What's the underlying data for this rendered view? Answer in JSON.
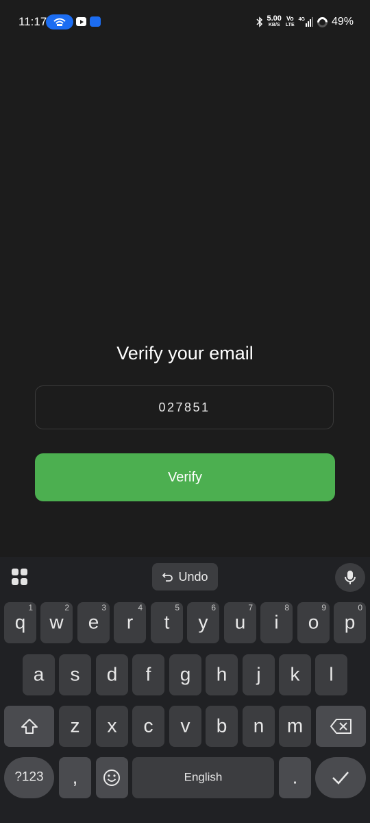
{
  "status_bar": {
    "time": "11:17",
    "net_speed_value": "5.00",
    "net_speed_unit": "KB/S",
    "volte_top": "Vo",
    "volte_bottom": "LTE",
    "network_type": "4G",
    "battery_percent": "49%",
    "icons": [
      "hotspot-icon",
      "youtube-icon",
      "app-icon",
      "bluetooth-icon",
      "signal-icon",
      "battery-icon"
    ]
  },
  "page": {
    "title": "Verify your email",
    "code_value": "027851",
    "verify_label": "Verify",
    "colors": {
      "background": "#1c1c1c",
      "accent": "#4caf50"
    }
  },
  "keyboard": {
    "undo_label": "Undo",
    "rows": {
      "row1": [
        {
          "label": "q",
          "hint": "1"
        },
        {
          "label": "w",
          "hint": "2"
        },
        {
          "label": "e",
          "hint": "3"
        },
        {
          "label": "r",
          "hint": "4"
        },
        {
          "label": "t",
          "hint": "5"
        },
        {
          "label": "y",
          "hint": "6"
        },
        {
          "label": "u",
          "hint": "7"
        },
        {
          "label": "i",
          "hint": "8"
        },
        {
          "label": "o",
          "hint": "9"
        },
        {
          "label": "p",
          "hint": "0"
        }
      ],
      "row2": [
        "a",
        "s",
        "d",
        "f",
        "g",
        "h",
        "j",
        "k",
        "l"
      ],
      "row3": [
        "z",
        "x",
        "c",
        "v",
        "b",
        "n",
        "m"
      ]
    },
    "symbols_label": "?123",
    "comma_label": ",",
    "space_label": "English",
    "period_label": "."
  }
}
